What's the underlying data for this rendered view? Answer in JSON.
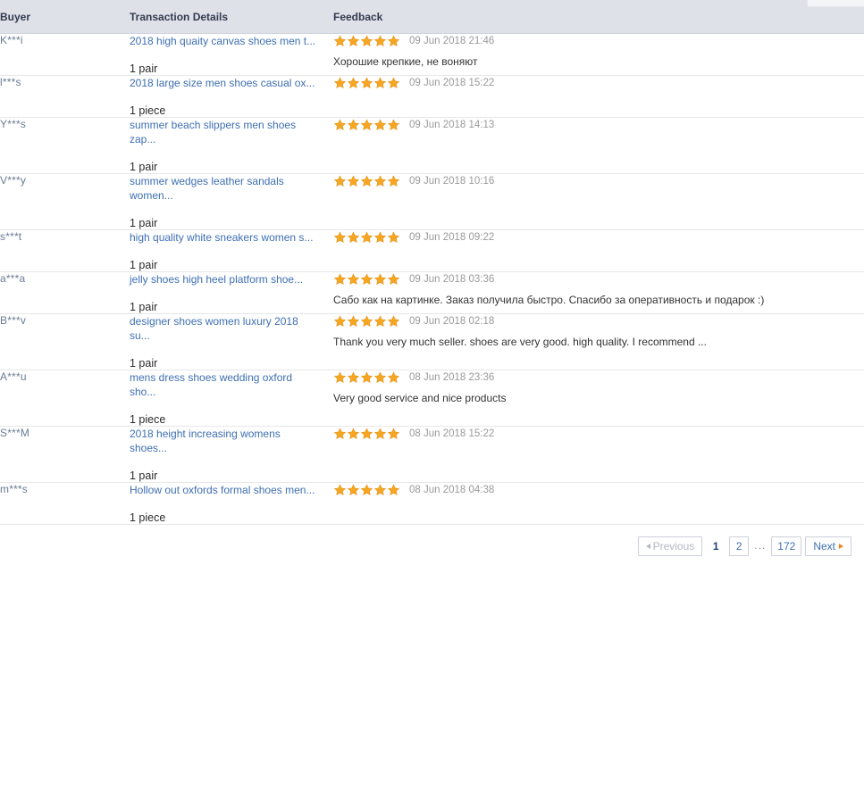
{
  "table": {
    "columns": [
      {
        "key": "buyer",
        "label": "Buyer"
      },
      {
        "key": "transaction",
        "label": "Transaction Details"
      },
      {
        "key": "feedback",
        "label": "Feedback"
      }
    ],
    "rows": [
      {
        "buyer": "K***i",
        "product": "2018 high quaity canvas shoes men t...",
        "quantity": "1 pair",
        "rating": 5,
        "date": "09 Jun 2018 21:46",
        "comment": "Хорошие крепкие, не воняют"
      },
      {
        "buyer": "l***s",
        "product": "2018 large size men shoes casual ox...",
        "quantity": "1 piece",
        "rating": 5,
        "date": "09 Jun 2018 15:22",
        "comment": ""
      },
      {
        "buyer": "Y***s",
        "product": "summer beach slippers men shoes zap...",
        "quantity": "1 pair",
        "rating": 5,
        "date": "09 Jun 2018 14:13",
        "comment": ""
      },
      {
        "buyer": "V***y",
        "product": "summer wedges leather sandals women...",
        "quantity": "1 pair",
        "rating": 5,
        "date": "09 Jun 2018 10:16",
        "comment": ""
      },
      {
        "buyer": "s***t",
        "product": "high quality white sneakers women s...",
        "quantity": "1 pair",
        "rating": 5,
        "date": "09 Jun 2018 09:22",
        "comment": ""
      },
      {
        "buyer": "a***a",
        "product": "jelly shoes high heel platform shoe...",
        "quantity": "1 pair",
        "rating": 5,
        "date": "09 Jun 2018 03:36",
        "comment": "Сабо как на картинке. Заказ получила быстро. Спасибо за оперативность и подарок :)"
      },
      {
        "buyer": "B***v",
        "product": "designer shoes women luxury 2018 su...",
        "quantity": "1 pair",
        "rating": 5,
        "date": "09 Jun 2018 02:18",
        "comment": "Thank you very much seller. shoes are very good. high quality. I recommend ..."
      },
      {
        "buyer": "A***u",
        "product": "mens dress shoes wedding oxford sho...",
        "quantity": "1 piece",
        "rating": 5,
        "date": "08 Jun 2018 23:36",
        "comment": "Very good service and nice products"
      },
      {
        "buyer": "S***M",
        "product": "2018 height increasing womens shoes...",
        "quantity": "1 pair",
        "rating": 5,
        "date": "08 Jun 2018 15:22",
        "comment": ""
      },
      {
        "buyer": "m***s",
        "product": "Hollow out oxfords formal shoes men...",
        "quantity": "1 piece",
        "rating": 5,
        "date": "08 Jun 2018 04:38",
        "comment": ""
      }
    ]
  },
  "pagination": {
    "previous_label": "Previous",
    "next_label": "Next",
    "ellipsis": "...",
    "current_page": "1",
    "pages": [
      "1",
      "2"
    ],
    "last_page": "172",
    "previous_disabled": true
  },
  "colors": {
    "header_bg": "#dfe1e9",
    "link": "#3e6fb3",
    "buyer": "#6b7b95",
    "star": "#f5a623",
    "date": "#9a9a9a",
    "next_arrow": "#f08519"
  }
}
